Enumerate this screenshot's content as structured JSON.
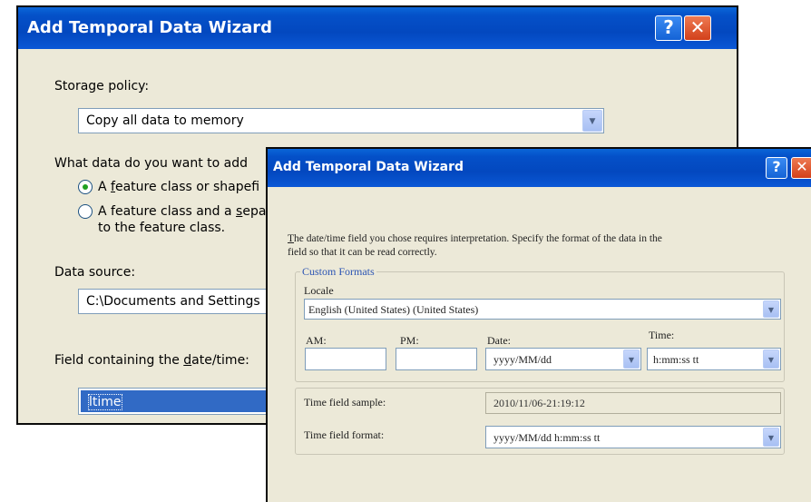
{
  "back_dialog": {
    "title": "Add Temporal Data Wizard",
    "help_glyph": "?",
    "close_glyph": "✕",
    "storage_label": "Storage policy:",
    "storage_value": "Copy all data to memory",
    "question_label": "What data do you want to add",
    "option1_prefix": "A ",
    "option1_underlined": "f",
    "option1_rest": "eature class or shapefi",
    "option2_prefix": "A feature class and a ",
    "option2_underlined": "s",
    "option2_rest": "eparate",
    "option2_line2": "to the feature class.",
    "data_source_label": "Data source:",
    "data_source_value": "C:\\Documents and Settings",
    "field_label_a": "Field containing the ",
    "field_label_underlined": "d",
    "field_label_b": "ate/time:",
    "field_value": "ltime",
    "selected_option": 1
  },
  "front_dialog": {
    "title": "Add Temporal Data Wizard",
    "help_glyph": "?",
    "close_glyph": "✕",
    "message_underlined": "T",
    "message_line1_rest": "he date/time field you chose requires interpretation.  Specify the format of the data in the",
    "message_line2": "field so that it can be read correctly.",
    "custom_formats_label": "Custom Formats",
    "locale_label": "Locale",
    "locale_value": "English (United States) (United States)",
    "am_label": "AM:",
    "pm_label": "PM:",
    "date_label": "Date:",
    "time_label": "Time:",
    "am_value": "",
    "pm_value": "",
    "date_value": "yyyy/MM/dd",
    "time_value": "h:mm:ss tt",
    "sample_label": "Time field sample:",
    "sample_value": "2010/11/06-21:19:12",
    "format_label": "Time field format:",
    "format_value": "yyyy/MM/dd h:mm:ss tt"
  },
  "icons": {
    "dropdown_arrow": "▼"
  },
  "colors": {
    "titlebar": "#0348bf",
    "dialog_bg": "#ece9d8",
    "selection": "#316ac5",
    "group_label": "#2b54b3",
    "close_button": "#d2401a"
  }
}
